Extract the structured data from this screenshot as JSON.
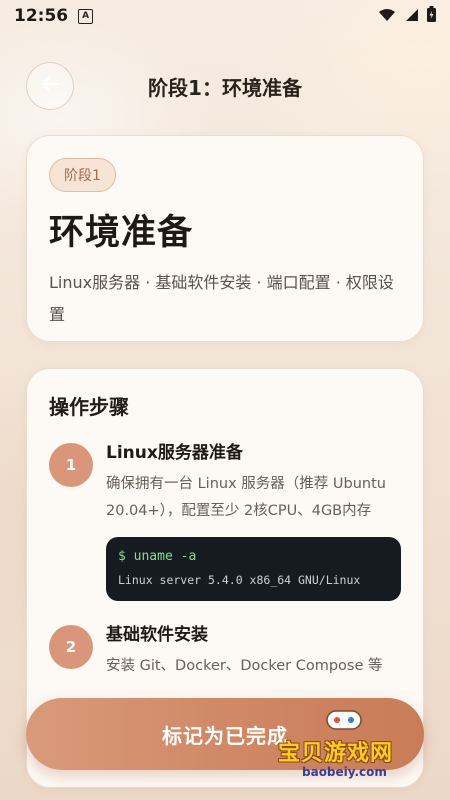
{
  "status_bar": {
    "time": "12:56",
    "notification_letter": "A"
  },
  "header": {
    "title": "阶段1：环境准备"
  },
  "hero": {
    "badge": "阶段1",
    "title": "环境准备",
    "description": "Linux服务器 · 基础软件安装 · 端口配置 · 权限设置"
  },
  "steps_card": {
    "heading": "操作步骤",
    "steps": [
      {
        "number": "1",
        "title": "Linux服务器准备",
        "description": "确保拥有一台 Linux 服务器（推荐 Ubuntu 20.04+），配置至少 2核CPU、4GB内存",
        "code_command": "$ uname -a",
        "code_output": "Linux server 5.4.0 x86_64 GNU/Linux"
      },
      {
        "number": "2",
        "title": "基础软件安装",
        "description": "安装 Git、Docker、Docker Compose 等"
      }
    ]
  },
  "actions": {
    "complete_label": "标记为已完成"
  },
  "watermark": {
    "text": "宝贝游戏网",
    "url": "baobeiy.com"
  },
  "colors": {
    "accent": "#d08a68",
    "badge_text": "#a86a4c",
    "code_bg": "#161b22",
    "code_command": "#7ee08a"
  }
}
